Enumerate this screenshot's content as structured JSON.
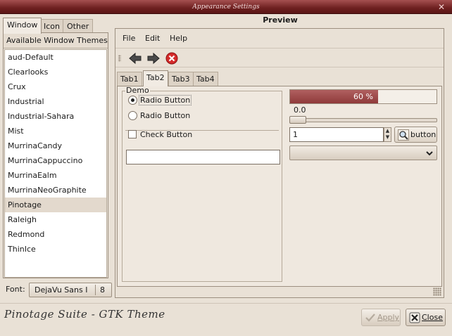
{
  "window": {
    "title": "Appearance Settings",
    "close_glyph": "✕"
  },
  "left_tabs": [
    "Window",
    "Icon",
    "Other"
  ],
  "themes": {
    "header": "Available Window Themes",
    "items": [
      "aud-Default",
      "Clearlooks",
      "Crux",
      "Industrial",
      "Industrial-Sahara",
      "Mist",
      "MurrinaCandy",
      "MurrinaCappuccino",
      "MurrinaEalm",
      "MurrinaNeoGraphite",
      "Pinotage",
      "Raleigh",
      "Redmond",
      "ThinIce"
    ],
    "selected": "Pinotage"
  },
  "font": {
    "label": "Font:",
    "name": "DejaVu Sans I",
    "size": "8"
  },
  "preview": {
    "title": "Preview",
    "menu": [
      "File",
      "Edit",
      "Help"
    ],
    "toolbar_icons": [
      "back-arrow-icon",
      "forward-arrow-icon",
      "stop-icon"
    ],
    "tabs": [
      "Tab1",
      "Tab2",
      "Tab3",
      "Tab4"
    ],
    "active_tab": "Tab2",
    "demo": {
      "legend": "Demo",
      "radio1": "Radio Button",
      "radio2": "Radio Button",
      "check": "Check Button",
      "entry_value": ""
    },
    "progress": {
      "fraction": 0.6,
      "text": "60 %"
    },
    "scale": {
      "value_text": "0.0"
    },
    "spin": {
      "value": "1"
    },
    "icon_button": {
      "label": "button",
      "icon": "magnifier-icon"
    },
    "combo": {
      "value": ""
    }
  },
  "footer": {
    "signature": "Pinotage Suite - GTK Theme",
    "apply": "Apply",
    "close": "Close"
  },
  "colors": {
    "accent": "#8f3a3a",
    "titlebar": "#6e2020",
    "background": "#e9e1d6"
  }
}
